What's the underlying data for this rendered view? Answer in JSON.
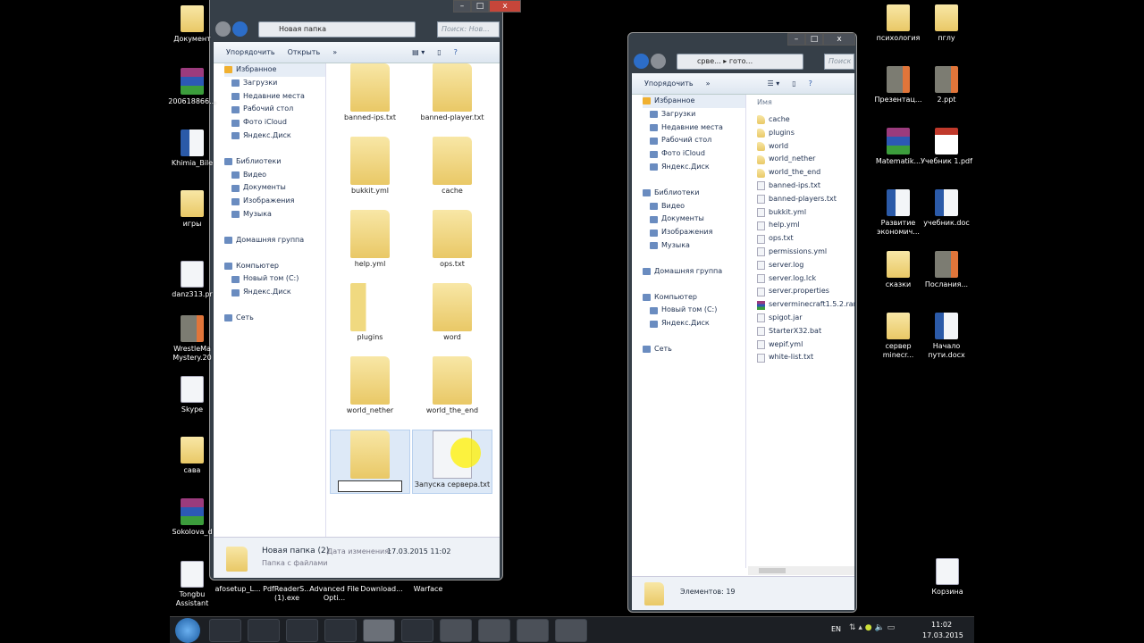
{
  "desktop": {
    "left_icons": [
      "Документ",
      "200618866...",
      "Khimia_Bile",
      "игры",
      "danz313.pr",
      "WrestleMa Mystery.20",
      "Skype",
      "сава",
      "Sokolova_d",
      "Tongbu Assistant"
    ],
    "bottom_icons": [
      "afosetup_L...",
      "PdfReaderS... (1).exe",
      "Advanced File Opti...",
      "Download...",
      "Warface"
    ],
    "right_icons": [
      "психология",
      "пглу",
      "Презентац...",
      "2.ppt",
      "Matematik...",
      "Учебник 1.pdf",
      "Развитие экономич...",
      "учебник.doc",
      "сказки",
      "Послания...",
      "сервер minecr...",
      "Начало пути.docx",
      "Корзина"
    ]
  },
  "left_window": {
    "address": "Новая папка",
    "search_placeholder": "Поиск: Нов...",
    "toolbar": {
      "organize": "Упорядочить",
      "open": "Открыть",
      "more": "»"
    },
    "nav": {
      "favorites": "Избранное",
      "fav_items": [
        "Загрузки",
        "Недавние места",
        "Рабочий стол",
        "Фото iCloud",
        "Яндекс.Диск"
      ],
      "libraries": "Библиотеки",
      "lib_items": [
        "Видео",
        "Документы",
        "Изображения",
        "Музыка"
      ],
      "homegroup": "Домашняя группа",
      "computer": "Компьютер",
      "comp_items": [
        "Новый том (C:)",
        "Яндекс.Диск"
      ],
      "network": "Сеть"
    },
    "items": [
      "banned-ips.txt",
      "banned-player.txt",
      "bukkit.yml",
      "cache",
      "help.yml",
      "ops.txt",
      "plugins",
      "word",
      "world_nether",
      "world_the_end",
      "",
      "Запуска сервера.txt"
    ],
    "details": {
      "name": "Новая папка (2)",
      "date_label": "Дата изменения:",
      "date": "17.03.2015 11:02",
      "type": "Папка с файлами"
    }
  },
  "right_window": {
    "address": "срве... ▸ гото...",
    "search_placeholder": "Поиск",
    "toolbar": {
      "organize": "Упорядочить",
      "more": "»"
    },
    "column": "Имя",
    "files": [
      "cache",
      "plugins",
      "world",
      "world_nether",
      "world_the_end",
      "banned-ips.txt",
      "banned-players.txt",
      "bukkit.yml",
      "help.yml",
      "ops.txt",
      "permissions.yml",
      "server.log",
      "server.log.lck",
      "server.properties",
      "serverminecraft1.5.2.rar",
      "spigot.jar",
      "StarterX32.bat",
      "wepif.yml",
      "white-list.txt"
    ],
    "status": "Элементов: 19"
  },
  "taskbar": {
    "lang": "EN",
    "time": "11:02",
    "date": "17.03.2015"
  }
}
